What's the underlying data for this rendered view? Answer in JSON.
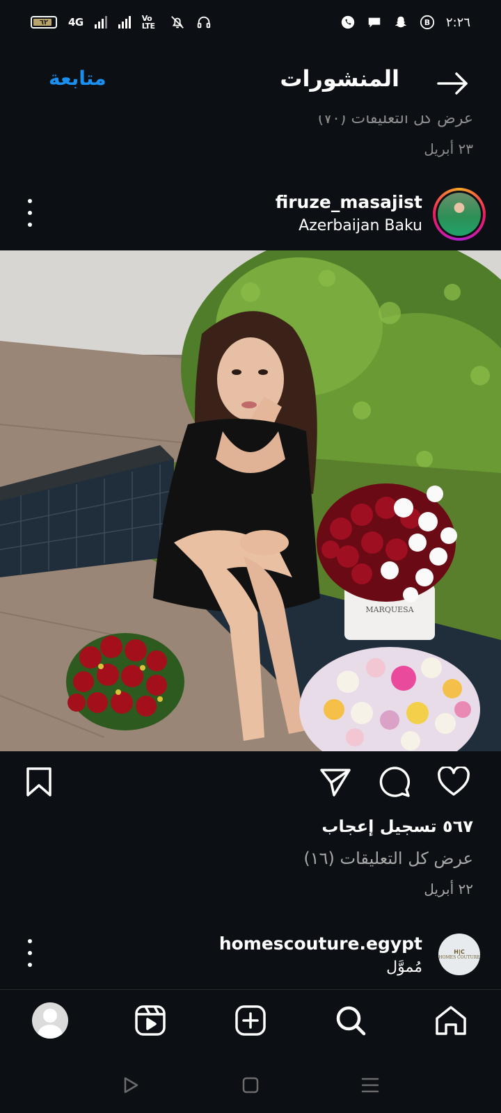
{
  "status_bar": {
    "battery": "٦٢",
    "network": "4G",
    "volte": "Vo LTE",
    "time": "٢:٢٦"
  },
  "header": {
    "title": "المنشورات",
    "follow": "متابعة",
    "back_icon": "arrow-right-icon"
  },
  "previous_post": {
    "comments_text": "عرض كل التعليقات (٧٠)",
    "date": "٢٣ أبريل"
  },
  "post": {
    "username": "firuze_masajist",
    "location": "Azerbaijan Baku",
    "image_label": "MARQUESA",
    "likes": "٥٦٧ تسجيل إعجاب",
    "comments_link": "عرض كل التعليقات (١٦)",
    "date": "٢٢ أبريل"
  },
  "next_post": {
    "username": "homescouture.egypt",
    "sponsored": "مُموَّل",
    "avatar_text": "HOMES COUTURE"
  },
  "colors": {
    "background": "#0c1014",
    "link_blue": "#1b8ff0",
    "secondary_text": "#a8a8a8"
  }
}
